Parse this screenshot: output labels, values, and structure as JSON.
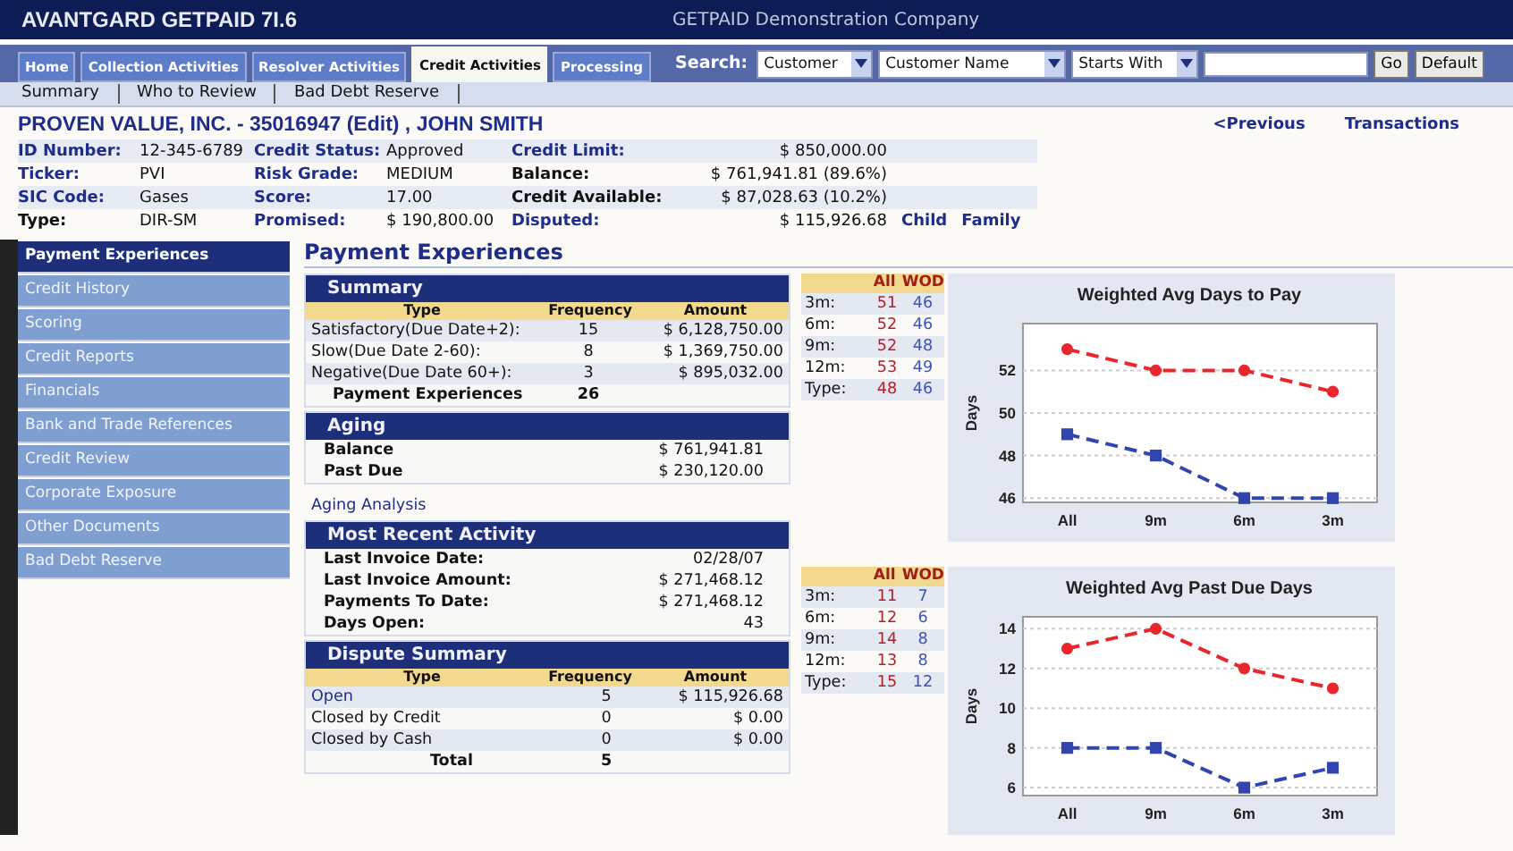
{
  "app": {
    "title": "AVANTGARD GETPAID 7I.6",
    "company": "GETPAID Demonstration Company"
  },
  "nav_tabs": [
    {
      "label": "Home",
      "selected": false
    },
    {
      "label": "Collection Activities",
      "selected": false
    },
    {
      "label": "Resolver Activities",
      "selected": false
    },
    {
      "label": "Credit Activities",
      "selected": true
    },
    {
      "label": "Processing",
      "selected": false
    }
  ],
  "search": {
    "label": "Search:",
    "selects": [
      "Customer",
      "Customer Name",
      "Starts With"
    ],
    "go_button": "Go",
    "default_button": "Default"
  },
  "sub_nav": [
    "Summary",
    "Who to Review",
    "Bad Debt Reserve"
  ],
  "customer": {
    "title": "PROVEN VALUE, INC. - 35016947 (Edit) , JOHN SMITH",
    "previous_link": "<Previous",
    "transactions_link": "Transactions"
  },
  "details": [
    [
      {
        "label": "ID Number:",
        "link": true,
        "value": "12-345-6789"
      },
      {
        "label": "Credit Status:",
        "link": true,
        "value": "Approved"
      },
      {
        "label": "Credit Limit:",
        "link": true,
        "value": "$ 850,000.00"
      }
    ],
    [
      {
        "label": "Ticker:",
        "link": true,
        "value": "PVI"
      },
      {
        "label": "Risk Grade:",
        "link": true,
        "value": "MEDIUM"
      },
      {
        "label": "Balance:",
        "link": false,
        "value": "$ 761,941.81 (89.6%)"
      }
    ],
    [
      {
        "label": "SIC Code:",
        "link": true,
        "value": "Gases"
      },
      {
        "label": "Score:",
        "link": true,
        "value": "17.00"
      },
      {
        "label": "Credit Available:",
        "link": false,
        "value": "$ 87,028.63 (10.2%)"
      }
    ],
    [
      {
        "label": "Type:",
        "link": false,
        "value": "DIR-SM"
      },
      {
        "label": "Promised:",
        "link": true,
        "value": "$ 190,800.00"
      },
      {
        "label": "Disputed:",
        "link": true,
        "value": "$ 115,926.68"
      }
    ]
  ],
  "detail_links": [
    "Child",
    "Family"
  ],
  "sidebar": [
    {
      "label": "Payment Experiences",
      "selected": true
    },
    {
      "label": "Credit History",
      "selected": false
    },
    {
      "label": "Scoring",
      "selected": false
    },
    {
      "label": "Credit Reports",
      "selected": false
    },
    {
      "label": "Financials",
      "selected": false
    },
    {
      "label": "Bank and Trade References",
      "selected": false
    },
    {
      "label": "Credit Review",
      "selected": false
    },
    {
      "label": "Corporate Exposure",
      "selected": false
    },
    {
      "label": "Other Documents",
      "selected": false
    },
    {
      "label": "Bad Debt Reserve",
      "selected": false
    }
  ],
  "page_title": "Payment Experiences",
  "summary": {
    "title": "Summary",
    "columns": [
      "Type",
      "Frequency",
      "Amount"
    ],
    "rows": [
      {
        "type": "Satisfactory(Due Date+2):",
        "frequency": "15",
        "amount": "$ 6,128,750.00"
      },
      {
        "type": "Slow(Due Date 2-60):",
        "frequency": "8",
        "amount": "$ 1,369,750.00"
      },
      {
        "type": "Negative(Due Date 60+):",
        "frequency": "3",
        "amount": "$ 895,032.00"
      }
    ],
    "total": {
      "label": "Payment Experiences",
      "frequency": "26"
    }
  },
  "aging": {
    "title": "Aging",
    "rows": [
      {
        "label": "Balance",
        "value": "$ 761,941.81"
      },
      {
        "label": "Past Due",
        "value": "$ 230,120.00"
      }
    ],
    "link": "Aging Analysis"
  },
  "recent_activity": {
    "title": "Most Recent Activity",
    "rows": [
      {
        "label": "Last Invoice Date:",
        "value": "02/28/07"
      },
      {
        "label": "Last Invoice Amount:",
        "value": "$ 271,468.12"
      },
      {
        "label": "Payments To Date:",
        "value": "$ 271,468.12"
      },
      {
        "label": "Days Open:",
        "value": "43"
      }
    ]
  },
  "dispute": {
    "title": "Dispute Summary",
    "columns": [
      "Type",
      "Frequency",
      "Amount"
    ],
    "rows": [
      {
        "type": "Open",
        "link": true,
        "frequency": "5",
        "amount": "$ 115,926.68"
      },
      {
        "type": "Closed by Credit",
        "link": false,
        "frequency": "0",
        "amount": "$ 0.00"
      },
      {
        "type": "Closed by Cash",
        "link": false,
        "frequency": "0",
        "amount": "$ 0.00"
      }
    ],
    "total": {
      "label": "Total",
      "frequency": "5"
    }
  },
  "stats": [
    {
      "rows": [
        {
          "label": "3m:",
          "all": "51",
          "wod": "46"
        },
        {
          "label": "6m:",
          "all": "52",
          "wod": "46"
        },
        {
          "label": "9m:",
          "all": "52",
          "wod": "48"
        },
        {
          "label": "12m:",
          "all": "53",
          "wod": "49"
        },
        {
          "label": "Type:",
          "all": "48",
          "wod": "46"
        }
      ],
      "chart_data": {
        "type": "line",
        "title": "Weighted Avg Days to Pay",
        "ylabel": "Days",
        "categories": [
          "All",
          "9m",
          "6m",
          "3m"
        ],
        "grid": true,
        "series": [
          {
            "name": "All",
            "color": "#e8262b",
            "line_style": "dashed",
            "marker": "circle",
            "values": [
              53,
              52,
              52,
              51
            ]
          },
          {
            "name": "WOD",
            "color": "#3144b0",
            "line_style": "dashed",
            "marker": "square",
            "values": [
              49,
              48,
              46,
              46
            ]
          }
        ],
        "ylim": [
          45.8,
          54.2
        ],
        "yticks": [
          46,
          48,
          50,
          52
        ]
      }
    },
    {
      "rows": [
        {
          "label": "3m:",
          "all": "11",
          "wod": "7"
        },
        {
          "label": "6m:",
          "all": "12",
          "wod": "6"
        },
        {
          "label": "9m:",
          "all": "14",
          "wod": "8"
        },
        {
          "label": "12m:",
          "all": "13",
          "wod": "8"
        },
        {
          "label": "Type:",
          "all": "15",
          "wod": "12"
        }
      ],
      "chart_data": {
        "type": "line",
        "title": "Weighted Avg Past Due Days",
        "ylabel": "Days",
        "categories": [
          "All",
          "9m",
          "6m",
          "3m"
        ],
        "grid": true,
        "series": [
          {
            "name": "All",
            "color": "#e8262b",
            "line_style": "dashed",
            "marker": "circle",
            "values": [
              13,
              14,
              12,
              11
            ]
          },
          {
            "name": "WOD",
            "color": "#3144b0",
            "line_style": "dashed",
            "marker": "square",
            "values": [
              8,
              8,
              6,
              7
            ]
          }
        ],
        "ylim": [
          5.6,
          14.6
        ],
        "yticks": [
          6,
          8,
          10,
          12,
          14
        ]
      }
    }
  ]
}
